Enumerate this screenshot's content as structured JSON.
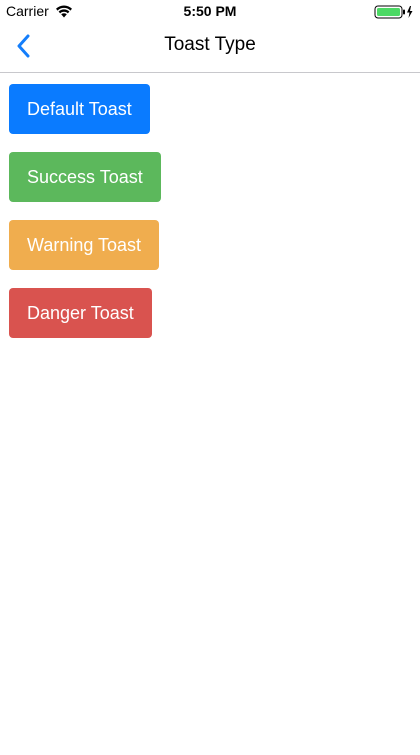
{
  "status_bar": {
    "carrier": "Carrier",
    "time": "5:50 PM",
    "wifi_icon": "wifi-icon",
    "battery_icon": "battery-charging-icon"
  },
  "nav": {
    "title": "Toast Type",
    "back_icon": "chevron-left-icon",
    "accent_color": "#147efb"
  },
  "buttons": [
    {
      "label": "Default Toast",
      "color": "#0a7bff"
    },
    {
      "label": "Success Toast",
      "color": "#5cb85c"
    },
    {
      "label": "Warning Toast",
      "color": "#f0ad4e"
    },
    {
      "label": "Danger Toast",
      "color": "#d9534f"
    }
  ]
}
